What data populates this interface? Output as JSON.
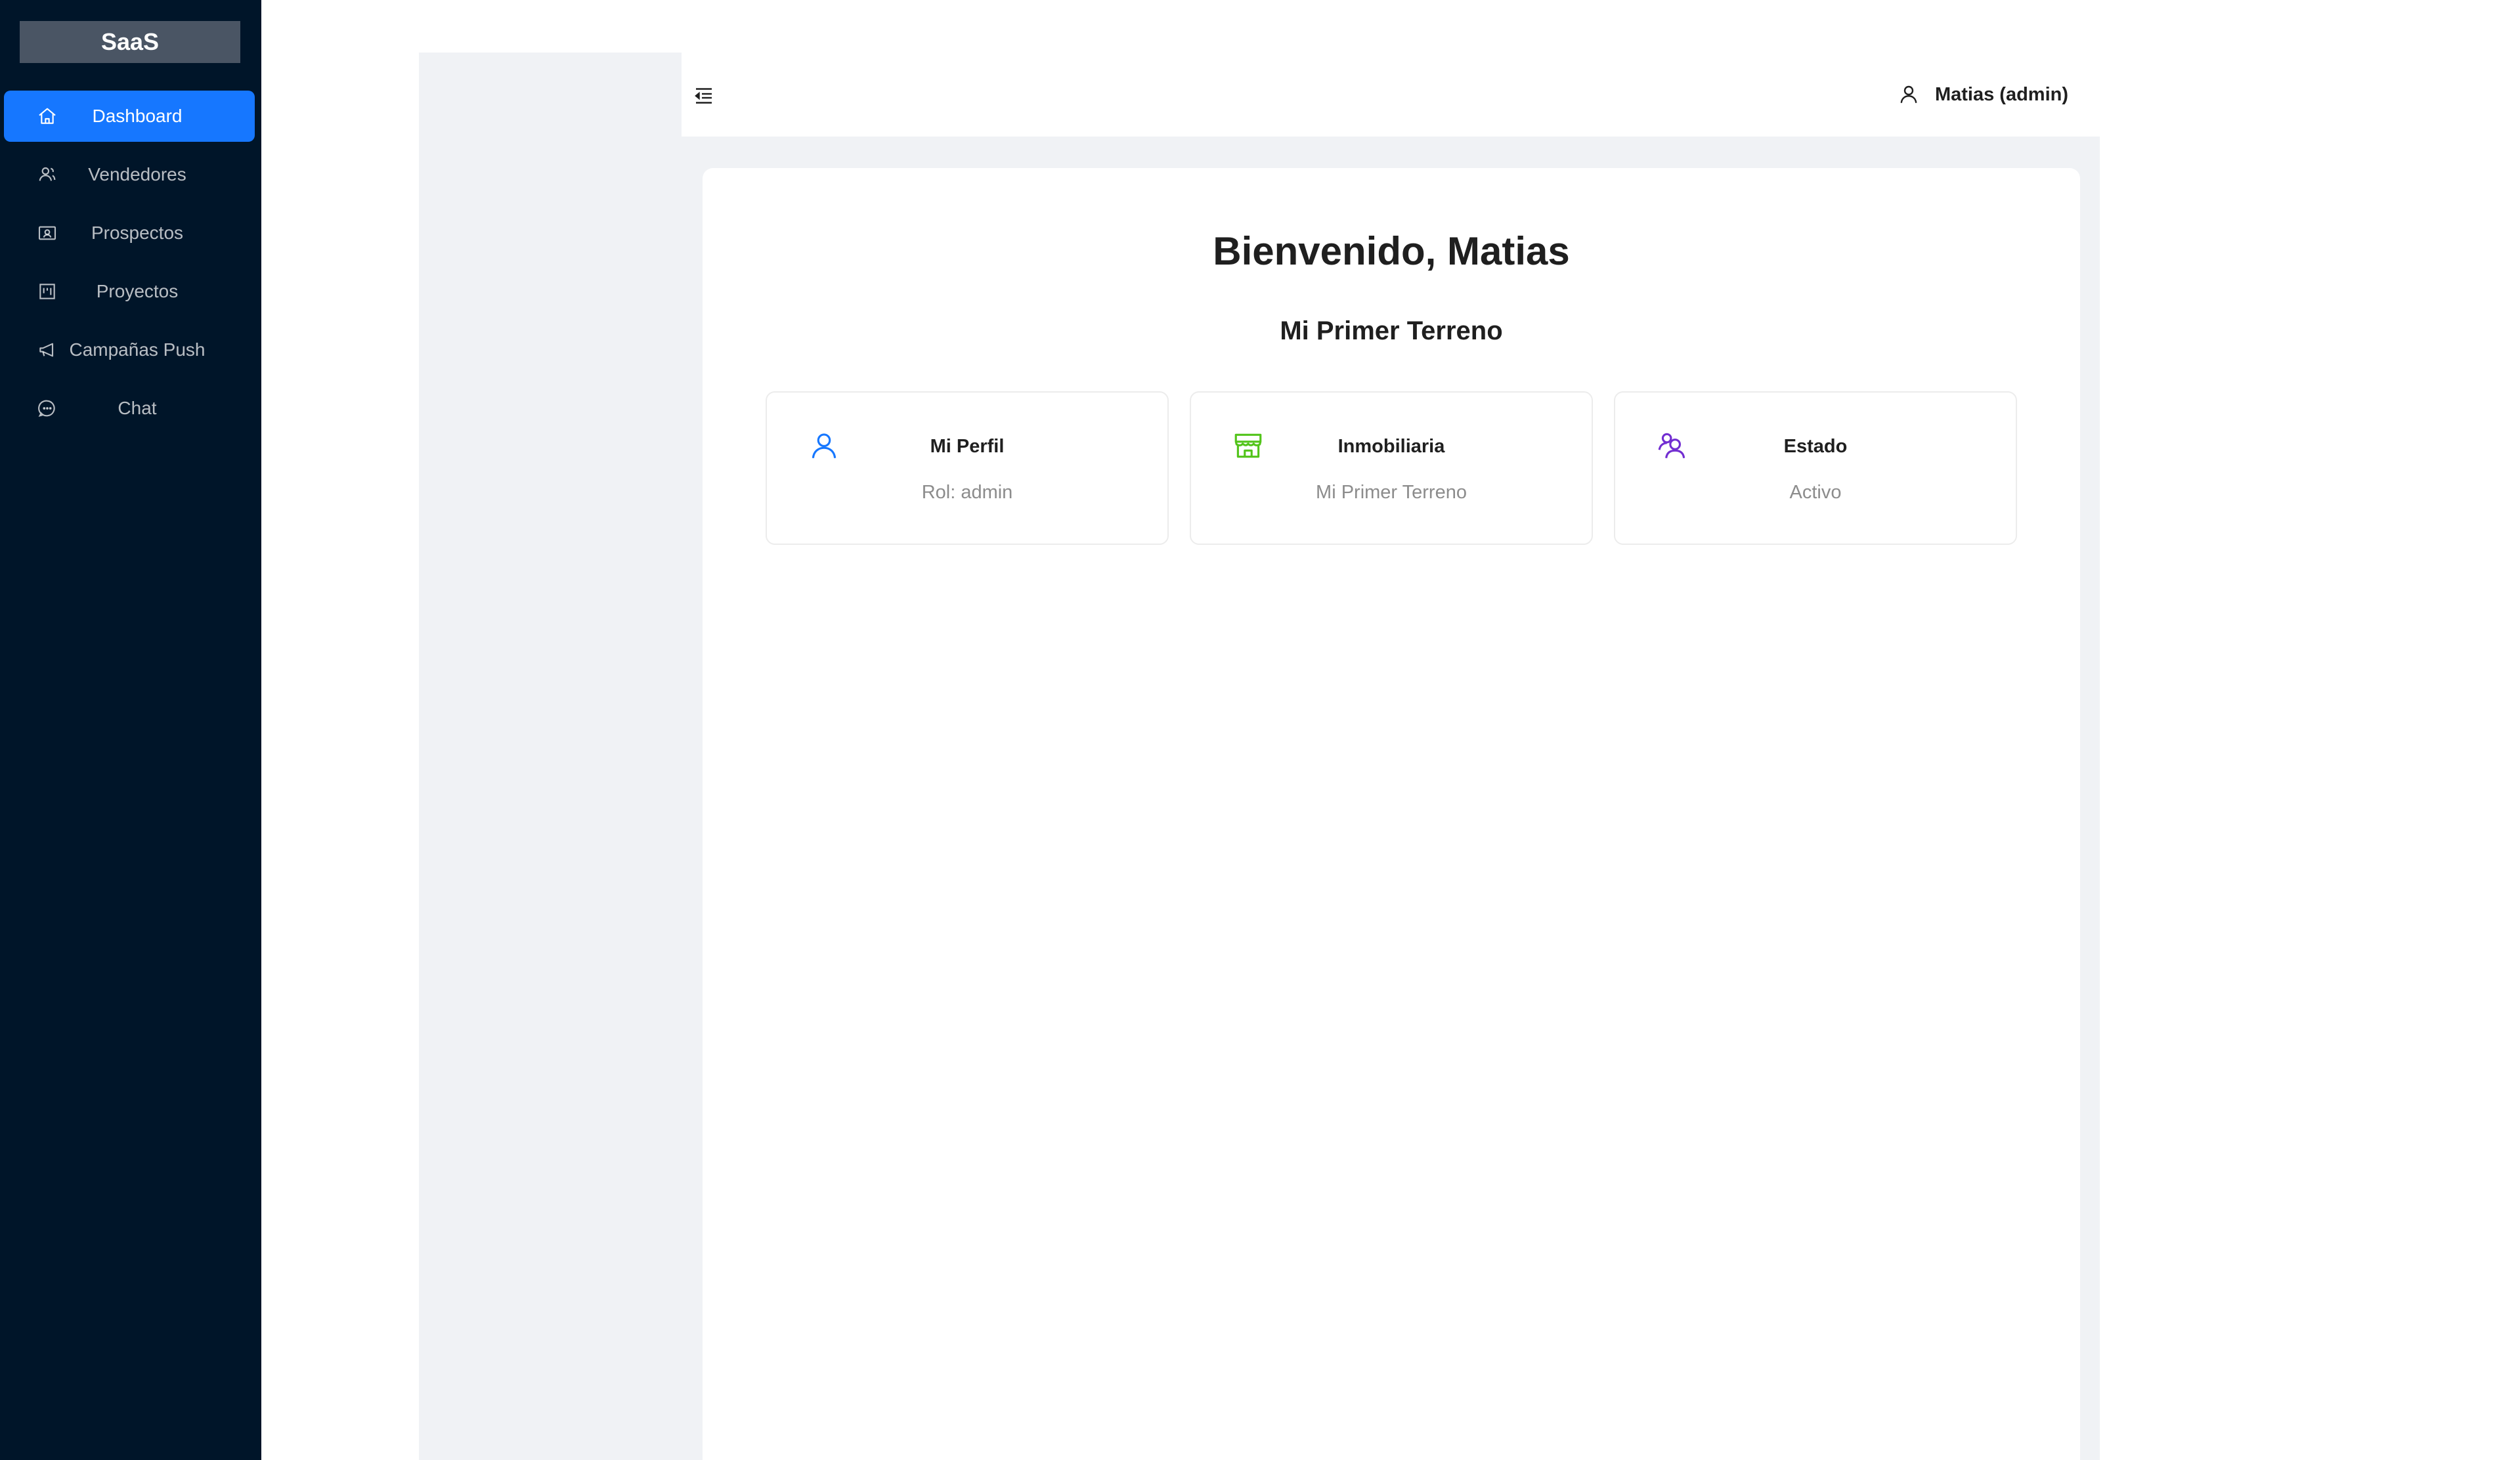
{
  "sidebar": {
    "logo": "SaaS",
    "items": [
      {
        "label": "Dashboard",
        "icon": "home-icon",
        "active": true
      },
      {
        "label": "Vendedores",
        "icon": "team-icon",
        "active": false
      },
      {
        "label": "Prospectos",
        "icon": "idcard-icon",
        "active": false
      },
      {
        "label": "Proyectos",
        "icon": "project-icon",
        "active": false
      },
      {
        "label": "Campañas Push",
        "icon": "notification-icon",
        "active": false
      },
      {
        "label": "Chat",
        "icon": "message-icon",
        "active": false
      }
    ]
  },
  "header": {
    "toggle_icon": "menu-fold-icon",
    "user_name": "Matias (admin)",
    "user_icon": "user-icon"
  },
  "main": {
    "welcome": "Bienvenido, Matias",
    "company": "Mi Primer Terreno",
    "cards": [
      {
        "title": "Mi Perfil",
        "value": "Rol: admin",
        "icon": "user-icon",
        "color": "#1677ff"
      },
      {
        "title": "Inmobiliaria",
        "value": "Mi Primer Terreno",
        "icon": "shop-icon",
        "color": "#52c41a"
      },
      {
        "title": "Estado",
        "value": "Activo",
        "icon": "team-icon",
        "color": "#722ed1"
      }
    ]
  },
  "colors": {
    "sidebar_bg": "#001529",
    "accent": "#1677ff",
    "layout_bg": "#f0f2f5"
  }
}
